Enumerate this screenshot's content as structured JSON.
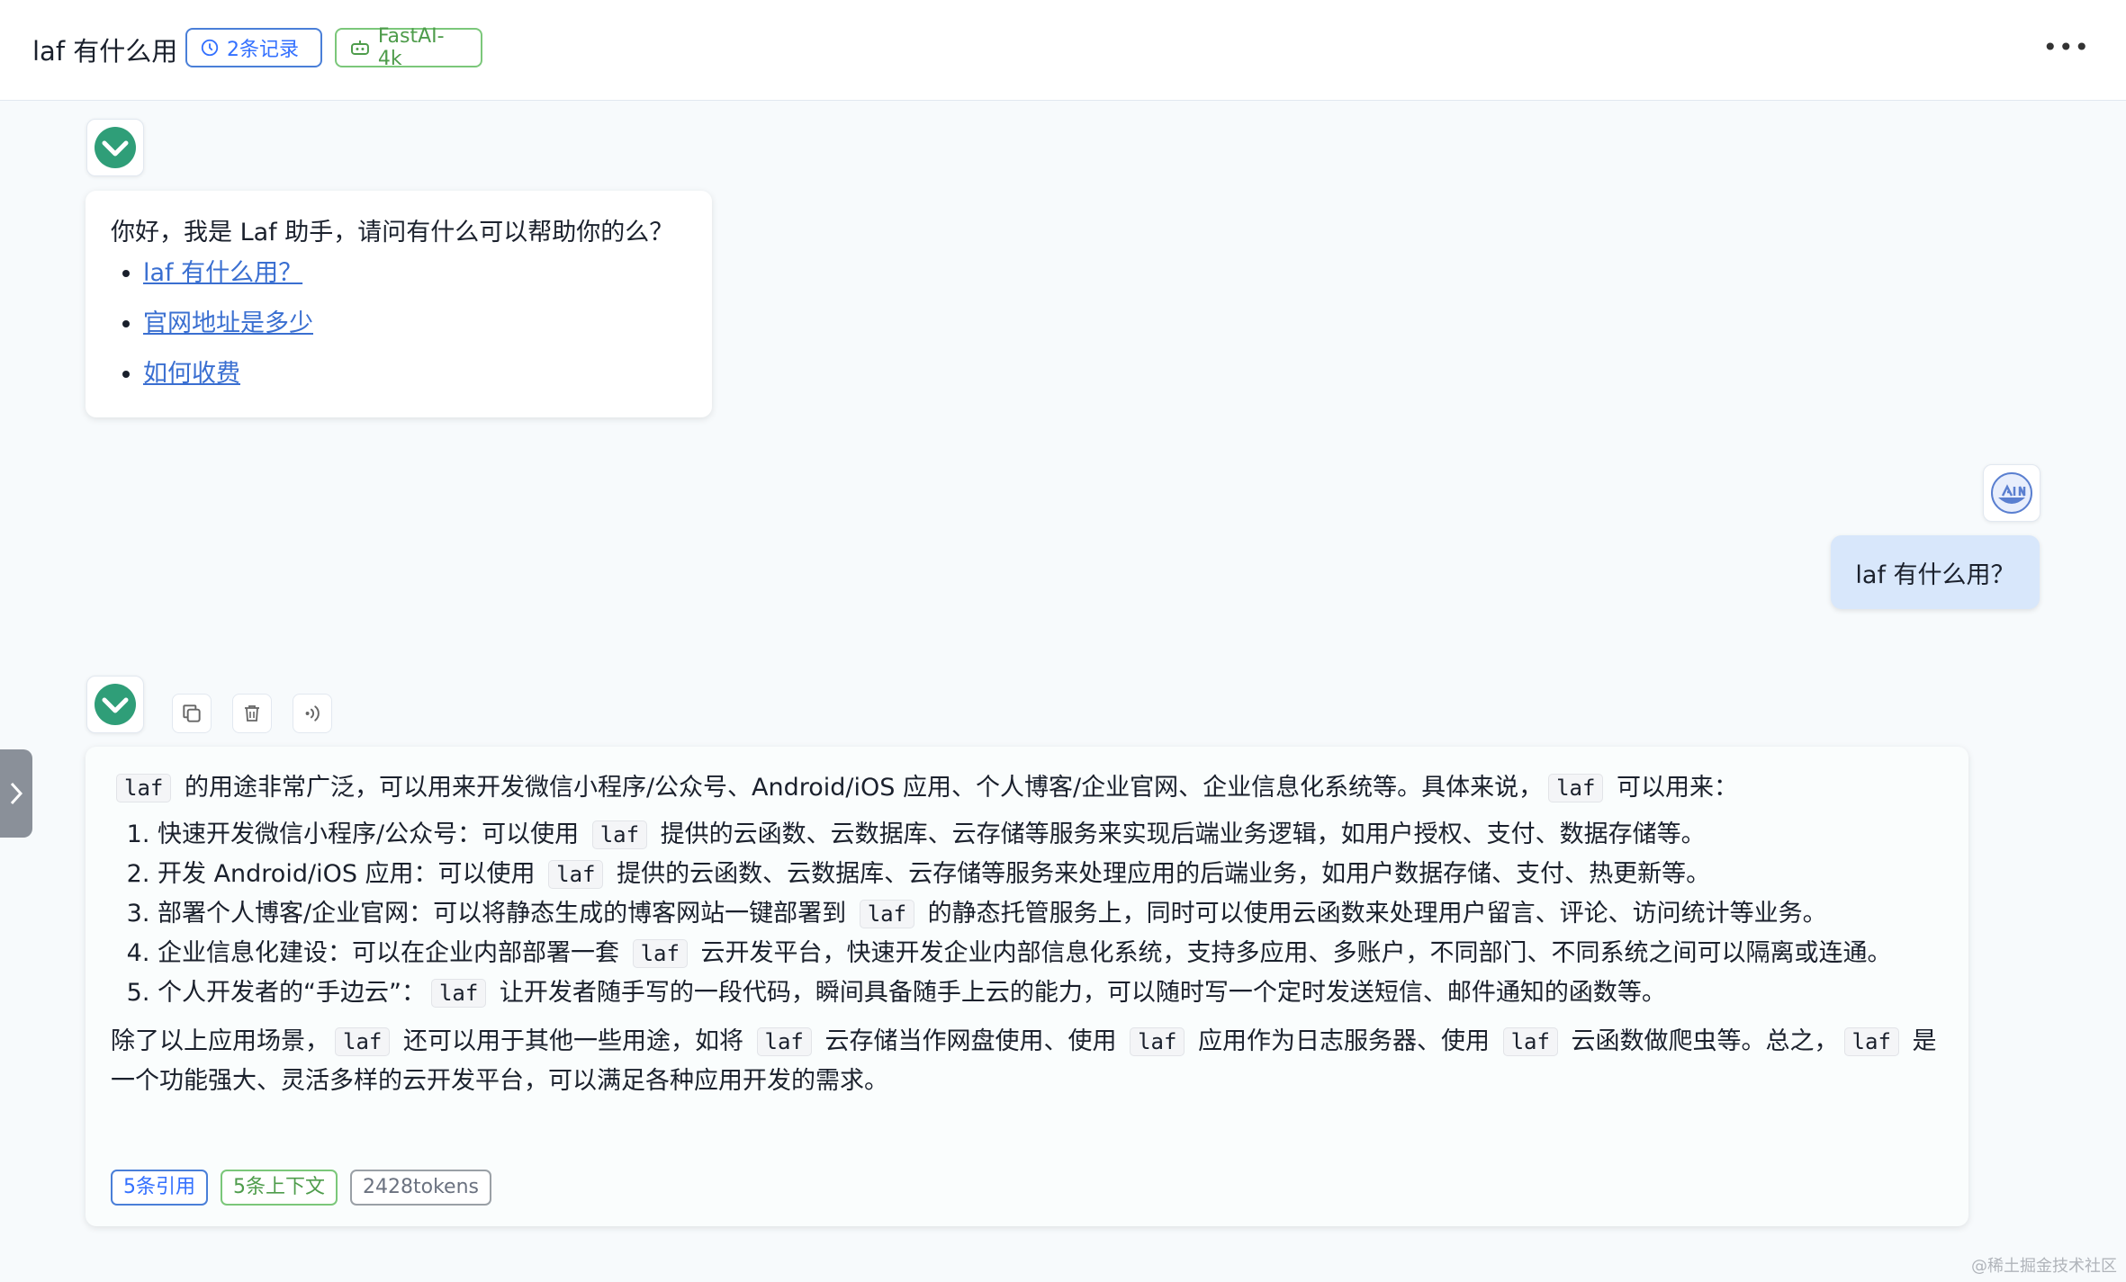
{
  "header": {
    "title": "laf 有什么用",
    "history_tag": "2条记录",
    "model_tag": "FastAI-4k",
    "more_label": "•••"
  },
  "welcome": {
    "greeting": "你好，我是 Laf 助手，请问有什么可以帮助你的么？",
    "suggestions": [
      "laf 有什么用？",
      "官网地址是多少",
      "如何收费"
    ]
  },
  "user_message": {
    "text": "laf 有什么用？"
  },
  "answer": {
    "intro": [
      "",
      "laf",
      " 的用途非常广泛，可以用来开发微信小程序/公众号、Android/iOS 应用、个人博客/企业官网、企业信息化系统等。具体来说，",
      "laf",
      " 可以用来："
    ],
    "items": [
      [
        "快速开发微信小程序/公众号：可以使用 ",
        "laf",
        " 提供的云函数、云数据库、云存储等服务来实现后端业务逻辑，如用户授权、支付、数据存储等。"
      ],
      [
        "开发 Android/iOS 应用：可以使用 ",
        "laf",
        " 提供的云函数、云数据库、云存储等服务来处理应用的后端业务，如用户数据存储、支付、热更新等。"
      ],
      [
        "部署个人博客/企业官网：可以将静态生成的博客网站一键部署到 ",
        "laf",
        " 的静态托管服务上，同时可以使用云函数来处理用户留言、评论、访问统计等业务。"
      ],
      [
        "企业信息化建设：可以在企业内部部署一套 ",
        "laf",
        " 云开发平台，快速开发企业内部信息化系统，支持多应用、多账户，不同部门、不同系统之间可以隔离或连通。"
      ],
      [
        "个人开发者的“手边云”：",
        "laf",
        " 让开发者随手写的一段代码，瞬间具备随手上云的能力，可以随时写一个定时发送短信、邮件通知的函数等。"
      ]
    ],
    "outro": [
      "除了以上应用场景，",
      "laf",
      " 还可以用于其他一些用途，如将 ",
      "laf",
      " 云存储当作网盘使用、使用 ",
      "laf",
      " 应用作为日志服务器、使用 ",
      "laf",
      " 云函数做爬虫等。总之，",
      "laf",
      " 是一个功能强大、灵活多样的云开发平台，可以满足各种应用开发的需求。"
    ],
    "tags": {
      "quotes": "5条引用",
      "context": "5条上下文",
      "tokens": "2428tokens"
    }
  },
  "watermark": "@稀土掘金技术社区",
  "colors": {
    "link": "#3a6fd1",
    "blue_tag": "#3370ff",
    "green_tag": "#4e9c4b",
    "brand_green": "#2f9e78"
  }
}
